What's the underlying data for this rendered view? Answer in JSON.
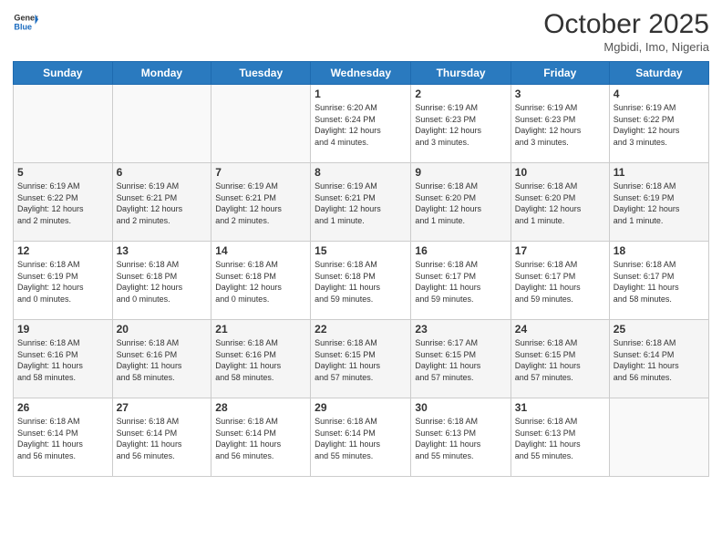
{
  "logo": {
    "general": "General",
    "blue": "Blue"
  },
  "header": {
    "month": "October 2025",
    "location": "Mgbidi, Imo, Nigeria"
  },
  "days_of_week": [
    "Sunday",
    "Monday",
    "Tuesday",
    "Wednesday",
    "Thursday",
    "Friday",
    "Saturday"
  ],
  "weeks": [
    [
      {
        "day": "",
        "info": ""
      },
      {
        "day": "",
        "info": ""
      },
      {
        "day": "",
        "info": ""
      },
      {
        "day": "1",
        "info": "Sunrise: 6:20 AM\nSunset: 6:24 PM\nDaylight: 12 hours\nand 4 minutes."
      },
      {
        "day": "2",
        "info": "Sunrise: 6:19 AM\nSunset: 6:23 PM\nDaylight: 12 hours\nand 3 minutes."
      },
      {
        "day": "3",
        "info": "Sunrise: 6:19 AM\nSunset: 6:23 PM\nDaylight: 12 hours\nand 3 minutes."
      },
      {
        "day": "4",
        "info": "Sunrise: 6:19 AM\nSunset: 6:22 PM\nDaylight: 12 hours\nand 3 minutes."
      }
    ],
    [
      {
        "day": "5",
        "info": "Sunrise: 6:19 AM\nSunset: 6:22 PM\nDaylight: 12 hours\nand 2 minutes."
      },
      {
        "day": "6",
        "info": "Sunrise: 6:19 AM\nSunset: 6:21 PM\nDaylight: 12 hours\nand 2 minutes."
      },
      {
        "day": "7",
        "info": "Sunrise: 6:19 AM\nSunset: 6:21 PM\nDaylight: 12 hours\nand 2 minutes."
      },
      {
        "day": "8",
        "info": "Sunrise: 6:19 AM\nSunset: 6:21 PM\nDaylight: 12 hours\nand 1 minute."
      },
      {
        "day": "9",
        "info": "Sunrise: 6:18 AM\nSunset: 6:20 PM\nDaylight: 12 hours\nand 1 minute."
      },
      {
        "day": "10",
        "info": "Sunrise: 6:18 AM\nSunset: 6:20 PM\nDaylight: 12 hours\nand 1 minute."
      },
      {
        "day": "11",
        "info": "Sunrise: 6:18 AM\nSunset: 6:19 PM\nDaylight: 12 hours\nand 1 minute."
      }
    ],
    [
      {
        "day": "12",
        "info": "Sunrise: 6:18 AM\nSunset: 6:19 PM\nDaylight: 12 hours\nand 0 minutes."
      },
      {
        "day": "13",
        "info": "Sunrise: 6:18 AM\nSunset: 6:18 PM\nDaylight: 12 hours\nand 0 minutes."
      },
      {
        "day": "14",
        "info": "Sunrise: 6:18 AM\nSunset: 6:18 PM\nDaylight: 12 hours\nand 0 minutes."
      },
      {
        "day": "15",
        "info": "Sunrise: 6:18 AM\nSunset: 6:18 PM\nDaylight: 11 hours\nand 59 minutes."
      },
      {
        "day": "16",
        "info": "Sunrise: 6:18 AM\nSunset: 6:17 PM\nDaylight: 11 hours\nand 59 minutes."
      },
      {
        "day": "17",
        "info": "Sunrise: 6:18 AM\nSunset: 6:17 PM\nDaylight: 11 hours\nand 59 minutes."
      },
      {
        "day": "18",
        "info": "Sunrise: 6:18 AM\nSunset: 6:17 PM\nDaylight: 11 hours\nand 58 minutes."
      }
    ],
    [
      {
        "day": "19",
        "info": "Sunrise: 6:18 AM\nSunset: 6:16 PM\nDaylight: 11 hours\nand 58 minutes."
      },
      {
        "day": "20",
        "info": "Sunrise: 6:18 AM\nSunset: 6:16 PM\nDaylight: 11 hours\nand 58 minutes."
      },
      {
        "day": "21",
        "info": "Sunrise: 6:18 AM\nSunset: 6:16 PM\nDaylight: 11 hours\nand 58 minutes."
      },
      {
        "day": "22",
        "info": "Sunrise: 6:18 AM\nSunset: 6:15 PM\nDaylight: 11 hours\nand 57 minutes."
      },
      {
        "day": "23",
        "info": "Sunrise: 6:17 AM\nSunset: 6:15 PM\nDaylight: 11 hours\nand 57 minutes."
      },
      {
        "day": "24",
        "info": "Sunrise: 6:18 AM\nSunset: 6:15 PM\nDaylight: 11 hours\nand 57 minutes."
      },
      {
        "day": "25",
        "info": "Sunrise: 6:18 AM\nSunset: 6:14 PM\nDaylight: 11 hours\nand 56 minutes."
      }
    ],
    [
      {
        "day": "26",
        "info": "Sunrise: 6:18 AM\nSunset: 6:14 PM\nDaylight: 11 hours\nand 56 minutes."
      },
      {
        "day": "27",
        "info": "Sunrise: 6:18 AM\nSunset: 6:14 PM\nDaylight: 11 hours\nand 56 minutes."
      },
      {
        "day": "28",
        "info": "Sunrise: 6:18 AM\nSunset: 6:14 PM\nDaylight: 11 hours\nand 56 minutes."
      },
      {
        "day": "29",
        "info": "Sunrise: 6:18 AM\nSunset: 6:14 PM\nDaylight: 11 hours\nand 55 minutes."
      },
      {
        "day": "30",
        "info": "Sunrise: 6:18 AM\nSunset: 6:13 PM\nDaylight: 11 hours\nand 55 minutes."
      },
      {
        "day": "31",
        "info": "Sunrise: 6:18 AM\nSunset: 6:13 PM\nDaylight: 11 hours\nand 55 minutes."
      },
      {
        "day": "",
        "info": ""
      }
    ]
  ]
}
